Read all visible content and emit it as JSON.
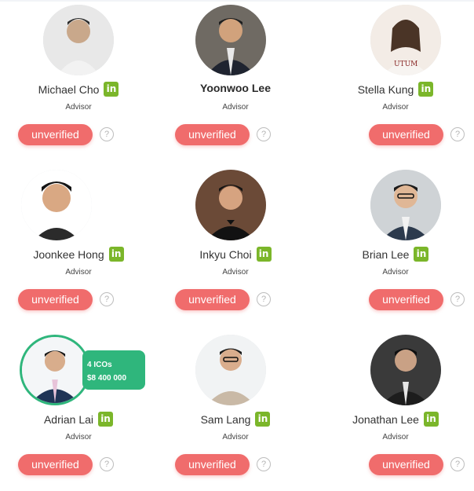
{
  "advisors": [
    {
      "name": "Michael Cho",
      "role": "Advisor",
      "status": "unverified",
      "linkedin": true,
      "bold": false
    },
    {
      "name": "Yoonwoo Lee",
      "role": "Advisor",
      "status": "unverified",
      "linkedin": false,
      "bold": true
    },
    {
      "name": "Stella Kung",
      "role": "Advisor",
      "status": "unverified",
      "linkedin": true,
      "bold": false
    },
    {
      "name": "Joonkee Hong",
      "role": "Advisor",
      "status": "unverified",
      "linkedin": true,
      "bold": false
    },
    {
      "name": "Inkyu Choi",
      "role": "Advisor",
      "status": "unverified",
      "linkedin": true,
      "bold": false
    },
    {
      "name": "Brian Lee",
      "role": "Advisor",
      "status": "unverified",
      "linkedin": true,
      "bold": false
    },
    {
      "name": "Adrian Lai",
      "role": "Advisor",
      "status": "unverified",
      "linkedin": true,
      "bold": false
    },
    {
      "name": "Sam Lang",
      "role": "Advisor",
      "status": "unverified",
      "linkedin": true,
      "bold": false
    },
    {
      "name": "Jonathan Lee",
      "role": "Advisor",
      "status": "unverified",
      "linkedin": true,
      "bold": false
    }
  ],
  "help_glyph": "?",
  "linkedin_glyph": "in",
  "ico_badge": {
    "line1": "4 ICOs",
    "line2": "$8 400 000"
  },
  "colors": {
    "unverified": "#f06c6c",
    "linkedin": "#7bb62a",
    "badge": "#2fb67c"
  },
  "icons": {
    "linkedin": "linkedin-icon",
    "help": "question-circle-icon"
  }
}
